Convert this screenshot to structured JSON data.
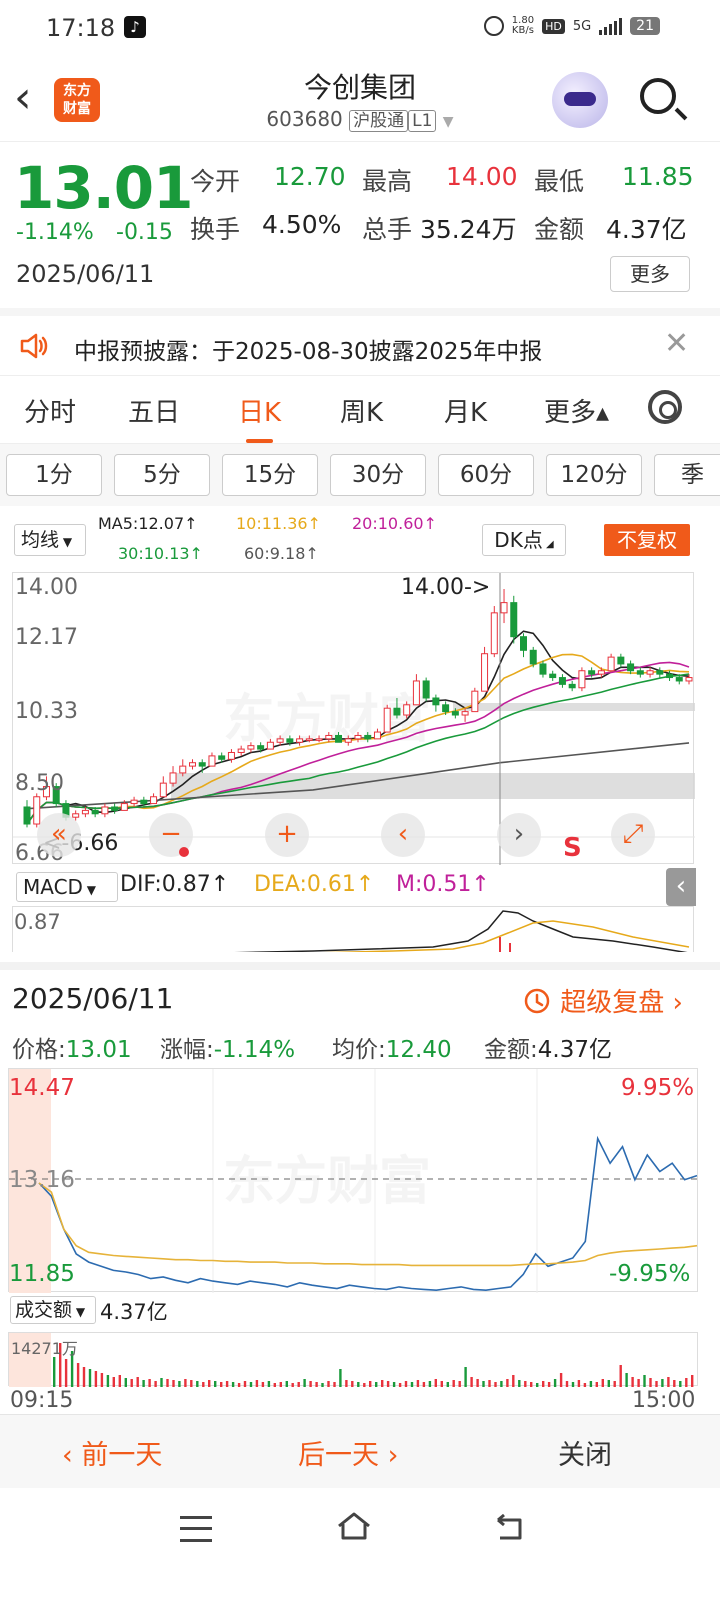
{
  "status": {
    "time": "17:18",
    "speed_top": "1.80",
    "speed_bottom": "KB/s",
    "hd": "HD",
    "net": "5G",
    "battery": "21"
  },
  "header": {
    "title": "今创集团",
    "code": "603680",
    "tag1": "沪股通",
    "tag2": "L1",
    "logo_line1": "东方",
    "logo_line2": "财富"
  },
  "quote": {
    "price": "13.01",
    "pct": "-1.14%",
    "chg": "-0.15",
    "date": "2025/06/11",
    "open_label": "今开",
    "open": "12.70",
    "high_label": "最高",
    "high": "14.00",
    "low_label": "最低",
    "low": "11.85",
    "turnover_label": "换手",
    "turnover": "4.50%",
    "volume_label": "总手",
    "volume": "35.24万",
    "amount_label": "金额",
    "amount": "4.37亿",
    "more": "更多"
  },
  "notice": {
    "text": "中报预披露：于2025-08-30披露2025年中报"
  },
  "tabs": [
    {
      "label": "分时"
    },
    {
      "label": "五日"
    },
    {
      "label": "日K",
      "active": true
    },
    {
      "label": "周K"
    },
    {
      "label": "月K"
    },
    {
      "label": "更多▴"
    }
  ],
  "intervals": [
    "1分",
    "5分",
    "15分",
    "30分",
    "60分",
    "120分",
    "季"
  ],
  "ma": {
    "selector": "均线",
    "ma5": "MA5:12.07↑",
    "ma10": "10:11.36↑",
    "ma20": "20:10.60↑",
    "ma30": "30:10.13↑",
    "ma60": "60:9.18↑",
    "dk": "DK点",
    "fuquan": "不复权"
  },
  "kline": {
    "labels": [
      "14.00",
      "12.17",
      "10.33",
      "8.50",
      "6.66"
    ],
    "high_marker": "14.00->",
    "low_marker": "<-6.66",
    "watermark": "东方财富",
    "signal": "S"
  },
  "macd": {
    "selector": "MACD",
    "dif": "DIF:0.87↑",
    "dea": "DEA:0.61↑",
    "m": "M:0.51↑",
    "axis": "0.87"
  },
  "popup": {
    "date": "2025/06/11",
    "super": "超级复盘",
    "price_label": "价格:",
    "price": "13.01",
    "pct_label": "涨幅:",
    "pct": "-1.14%",
    "avg_label": "均价:",
    "avg": "12.40",
    "amount_label": "金额:",
    "amount": "4.37亿",
    "tl_high": "14.47",
    "tl_mid": "13.16",
    "tl_low": "11.85",
    "tl_up": "9.95%",
    "tl_down": "-9.95%",
    "watermark": "东方财富",
    "vol_selector": "成交额",
    "vol_value": "4.37亿",
    "vol_max": "14271万",
    "t_start": "09:15",
    "t_end": "15:00"
  },
  "actions": {
    "prev": "前一天",
    "next": "后一天",
    "close": "关闭"
  },
  "colors": {
    "up": "#e8323c",
    "down": "#199a3b",
    "accent": "#f05a1a"
  },
  "chart_data": [
    {
      "type": "candlestick",
      "title": "",
      "yticks": [
        "14.00",
        "12.17",
        "10.33",
        "8.50",
        "6.66"
      ],
      "ylim": [
        6.66,
        14.0
      ],
      "ma": {
        "MA5": 12.07,
        "MA10": 11.36,
        "MA20": 10.6,
        "MA30": 10.13,
        "MA60": 9.18
      },
      "candles": [
        [
          7.6,
          7.1,
          7.8,
          7.0
        ],
        [
          7.1,
          7.9,
          8.0,
          7.0
        ],
        [
          7.9,
          8.2,
          8.5,
          7.8
        ],
        [
          8.2,
          7.7,
          8.3,
          7.6
        ],
        [
          7.7,
          7.3,
          7.8,
          7.2
        ],
        [
          7.3,
          7.4,
          7.5,
          7.2
        ],
        [
          7.4,
          7.5,
          7.6,
          7.3
        ],
        [
          7.5,
          7.4,
          7.6,
          7.3
        ],
        [
          7.4,
          7.6,
          7.7,
          7.3
        ],
        [
          7.6,
          7.5,
          7.7,
          7.4
        ],
        [
          7.5,
          7.7,
          7.8,
          7.5
        ],
        [
          7.7,
          7.8,
          7.9,
          7.6
        ],
        [
          7.8,
          7.7,
          7.9,
          7.6
        ],
        [
          7.7,
          7.9,
          8.0,
          7.7
        ],
        [
          7.9,
          8.3,
          8.5,
          7.9
        ],
        [
          8.3,
          8.6,
          8.8,
          8.2
        ],
        [
          8.6,
          8.8,
          9.0,
          8.5
        ],
        [
          8.8,
          8.9,
          9.0,
          8.7
        ],
        [
          8.9,
          8.8,
          9.0,
          8.6
        ],
        [
          8.8,
          9.1,
          9.2,
          8.8
        ],
        [
          9.1,
          9.0,
          9.2,
          8.9
        ],
        [
          9.0,
          9.2,
          9.3,
          8.9
        ],
        [
          9.2,
          9.3,
          9.4,
          9.1
        ],
        [
          9.3,
          9.4,
          9.5,
          9.2
        ],
        [
          9.4,
          9.3,
          9.5,
          9.2
        ],
        [
          9.3,
          9.5,
          9.6,
          9.3
        ],
        [
          9.5,
          9.6,
          9.7,
          9.4
        ],
        [
          9.6,
          9.5,
          9.7,
          9.4
        ],
        [
          9.5,
          9.6,
          9.7,
          9.4
        ],
        [
          9.6,
          9.6,
          9.7,
          9.5
        ],
        [
          9.6,
          9.6,
          9.7,
          9.5
        ],
        [
          9.6,
          9.7,
          9.8,
          9.5
        ],
        [
          9.7,
          9.5,
          9.8,
          9.5
        ],
        [
          9.5,
          9.6,
          9.7,
          9.4
        ],
        [
          9.6,
          9.7,
          9.8,
          9.5
        ],
        [
          9.7,
          9.6,
          9.8,
          9.5
        ],
        [
          9.6,
          9.8,
          9.9,
          9.6
        ],
        [
          9.8,
          10.5,
          10.6,
          9.8
        ],
        [
          10.5,
          10.3,
          10.8,
          10.2
        ],
        [
          10.3,
          10.6,
          10.7,
          10.2
        ],
        [
          10.6,
          11.3,
          11.5,
          10.6
        ],
        [
          11.3,
          10.8,
          11.4,
          10.7
        ],
        [
          10.8,
          10.6,
          10.9,
          10.4
        ],
        [
          10.6,
          10.4,
          10.7,
          10.3
        ],
        [
          10.4,
          10.3,
          10.5,
          10.2
        ],
        [
          10.3,
          10.4,
          10.5,
          10.1
        ],
        [
          10.4,
          11.0,
          11.1,
          10.4
        ],
        [
          11.0,
          12.1,
          12.3,
          11.0
        ],
        [
          12.1,
          13.3,
          13.5,
          12.0
        ],
        [
          13.3,
          13.6,
          14.0,
          13.0
        ],
        [
          13.6,
          12.6,
          13.8,
          12.4
        ],
        [
          12.6,
          12.2,
          12.7,
          12.0
        ],
        [
          12.2,
          11.8,
          12.3,
          11.7
        ],
        [
          11.8,
          11.5,
          11.9,
          11.4
        ],
        [
          11.5,
          11.4,
          11.6,
          11.3
        ],
        [
          11.4,
          11.2,
          11.5,
          11.1
        ],
        [
          11.2,
          11.1,
          11.3,
          11.0
        ],
        [
          11.1,
          11.6,
          11.7,
          11.0
        ],
        [
          11.6,
          11.5,
          11.7,
          11.4
        ],
        [
          11.5,
          11.6,
          11.7,
          11.4
        ],
        [
          11.6,
          12.0,
          12.1,
          11.6
        ],
        [
          12.0,
          11.8,
          12.1,
          11.7
        ],
        [
          11.8,
          11.6,
          11.9,
          11.5
        ],
        [
          11.6,
          11.5,
          11.7,
          11.4
        ],
        [
          11.5,
          11.6,
          11.7,
          11.4
        ],
        [
          11.6,
          11.5,
          11.7,
          11.4
        ],
        [
          11.5,
          11.4,
          11.6,
          11.3
        ],
        [
          11.4,
          11.3,
          11.5,
          11.2
        ],
        [
          11.3,
          11.4,
          11.5,
          11.2
        ]
      ]
    },
    {
      "type": "line",
      "title": "",
      "yticks": [
        "14.47",
        "13.16",
        "11.85"
      ],
      "ylim": [
        11.85,
        14.47
      ],
      "series": [
        {
          "values": [
            13.16,
            13.0,
            12.6,
            12.3,
            12.2,
            12.15,
            12.1,
            12.08,
            12.05,
            12.0,
            12.02,
            11.98,
            11.95,
            12.0,
            11.97,
            11.95,
            11.93,
            11.97,
            11.95,
            11.93,
            11.9,
            11.95,
            11.92,
            11.9,
            11.88,
            11.92,
            11.9,
            11.88,
            11.87,
            11.9,
            11.88,
            11.87,
            11.86,
            11.88,
            11.9,
            11.87,
            11.86,
            11.88,
            11.9,
            12.05,
            12.3,
            12.15,
            12.2,
            12.25,
            12.45,
            13.7,
            13.4,
            13.6,
            13.2,
            13.5,
            13.3,
            13.4,
            13.2,
            13.25
          ]
        },
        {
          "values": [
            13.16,
            13.05,
            12.6,
            12.4,
            12.32,
            12.3,
            12.28,
            12.27,
            12.26,
            12.25,
            12.24,
            12.23,
            12.23,
            12.22,
            12.22,
            12.21,
            12.21,
            12.2,
            12.2,
            12.2,
            12.19,
            12.19,
            12.19,
            12.18,
            12.18,
            12.18,
            12.17,
            12.17,
            12.17,
            12.17,
            12.16,
            12.16,
            12.16,
            12.16,
            12.16,
            12.16,
            12.16,
            12.16,
            12.16,
            12.17,
            12.18,
            12.18,
            12.19,
            12.2,
            12.22,
            12.28,
            12.31,
            12.33,
            12.34,
            12.35,
            12.36,
            12.37,
            12.38,
            12.4
          ]
        }
      ]
    }
  ]
}
